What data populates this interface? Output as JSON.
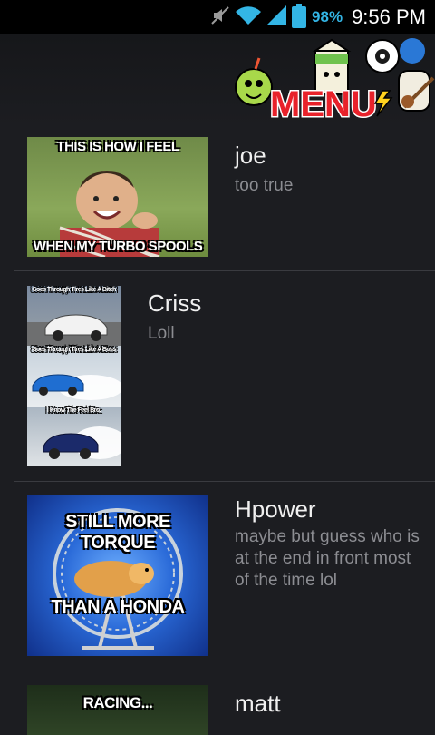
{
  "status_bar": {
    "battery": "98%",
    "time": "9:56 PM",
    "icons": [
      "mute-icon",
      "wifi-icon",
      "signal-icon",
      "battery-icon"
    ]
  },
  "header": {
    "logo_text": "MENU"
  },
  "items": [
    {
      "name": "joe",
      "message": "too true",
      "image_top": "THIS IS HOW I FEEL",
      "image_bottom": "WHEN MY TURBO SPOOLS"
    },
    {
      "name": "Criss",
      "message": "Loll",
      "panels": [
        "Goes Through Tires Like A Bitch",
        "Goes Through Tires Like A Boss",
        "I Know The Feel Bro."
      ]
    },
    {
      "name": "Hpower",
      "message": "maybe but guess who is at the end in front most of the time lol",
      "image_top": "STILL MORE TORQUE",
      "image_bottom": "THAN A HONDA"
    },
    {
      "name": "matt",
      "message": "",
      "image_top": "RACING..."
    }
  ],
  "colors": {
    "background": "#1c1d21",
    "accent": "#33b5e5",
    "divider": "#3a3b40"
  }
}
